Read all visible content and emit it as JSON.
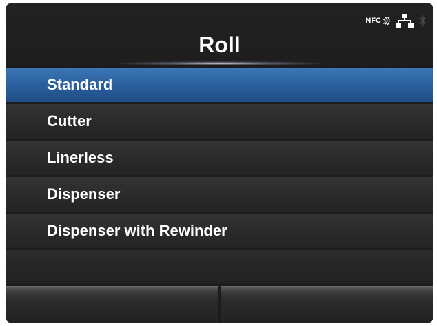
{
  "header": {
    "title": "Roll",
    "status_icons": [
      {
        "name": "nfc-icon",
        "label": "NFC"
      },
      {
        "name": "network-icon"
      },
      {
        "name": "bluetooth-icon"
      }
    ]
  },
  "menu": {
    "items": [
      {
        "label": "Standard",
        "selected": true
      },
      {
        "label": "Cutter",
        "selected": false
      },
      {
        "label": "Linerless",
        "selected": false
      },
      {
        "label": "Dispenser",
        "selected": false
      },
      {
        "label": "Dispenser with Rewinder",
        "selected": false
      }
    ]
  },
  "softkeys": {
    "left_label": "",
    "right_label": ""
  },
  "colors": {
    "selected_row": "#2a5f9d",
    "row": "#2e2e2e",
    "screen_bg": "#1c1c1c",
    "text": "#ffffff"
  }
}
